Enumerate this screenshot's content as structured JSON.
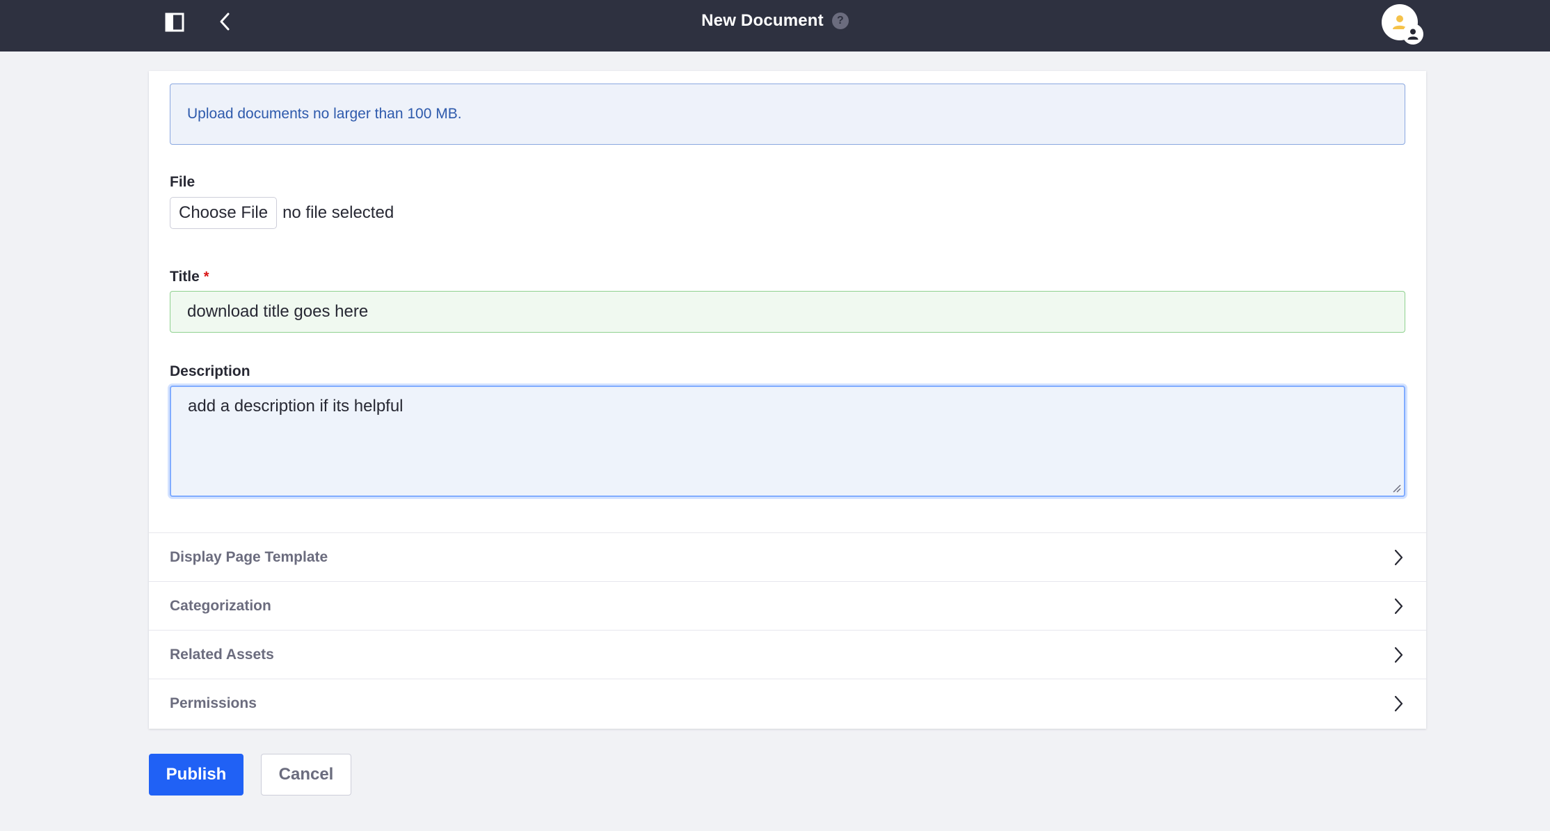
{
  "header": {
    "title": "New Document",
    "help_glyph": "?",
    "icons": {
      "panel_toggle": "sidebar-toggle-icon",
      "back": "chevron-left-icon",
      "avatar": "user-avatar-icon"
    }
  },
  "form": {
    "alert_text": "Upload documents no larger than 100 MB.",
    "file": {
      "label": "File",
      "button_label": "Choose File",
      "status": "no file selected"
    },
    "title_field": {
      "label": "Title",
      "required_mark": "*",
      "value": "download title goes here"
    },
    "description_field": {
      "label": "Description",
      "value": "add a description if its helpful"
    }
  },
  "panels": [
    {
      "label": "Display Page Template"
    },
    {
      "label": "Categorization"
    },
    {
      "label": "Related Assets"
    },
    {
      "label": "Permissions"
    }
  ],
  "actions": {
    "publish_label": "Publish",
    "cancel_label": "Cancel"
  },
  "colors": {
    "topbar_bg": "#2e3140",
    "primary": "#2061f5",
    "alert_text": "#2e5aac",
    "required": "#da1414",
    "valid_border": "#8fd18f",
    "focus_border": "#80acff"
  }
}
